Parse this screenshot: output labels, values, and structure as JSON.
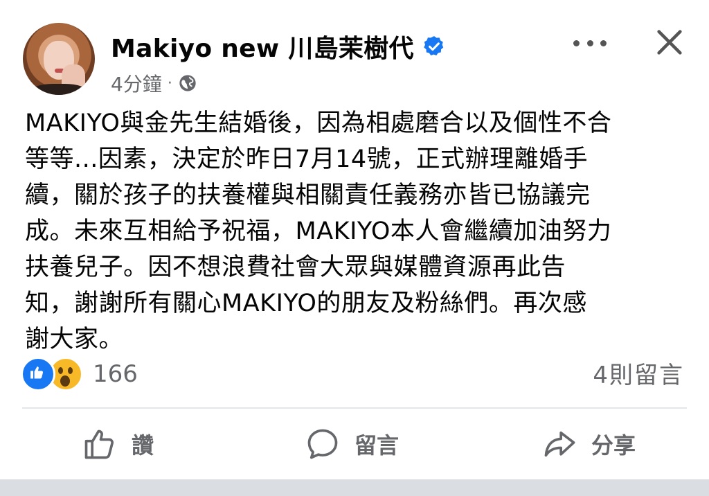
{
  "post": {
    "author_name": "Makiyo new 川島茉樹代",
    "time": "4分鐘",
    "separator": "·",
    "text_lines": [
      "MAKIYO與金先生結婚後，因為相處磨合以及個性不合",
      "等等...因素，決定於昨日7月14號，正式辦理離婚手",
      "續，關於孩子的扶養權與相關責任義務亦皆已協議完",
      "成。未來互相給予祝福，MAKIYO本人會繼續加油努力",
      "扶養兒子。因不想浪費社會大眾與媒體資源再此告",
      "知，謝謝所有關心MAKIYO的朋友及粉絲們。再次感",
      "謝大家。"
    ],
    "reaction_count": "166",
    "comment_count": "4則留言"
  },
  "actions": {
    "like_label": "讚",
    "comment_label": "留言",
    "share_label": "分享"
  },
  "icons": {
    "verified": "verified-badge-icon",
    "privacy": "globe-icon",
    "more": "more-dots-icon",
    "close": "close-icon",
    "like": "thumbs-up-icon",
    "comment": "comment-bubble-icon",
    "share": "share-arrow-icon"
  },
  "colors": {
    "accent": "#1877f2",
    "text": "#050505",
    "muted": "#65676b",
    "wow": "#f7b928"
  }
}
